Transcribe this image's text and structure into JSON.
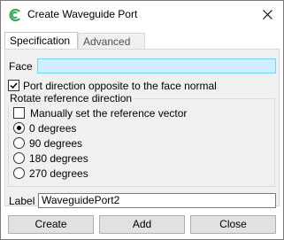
{
  "window": {
    "title": "Create Waveguide Port",
    "app_icon": "cst-logo-icon",
    "close_icon": "close-icon"
  },
  "tabs": [
    {
      "label": "Specification",
      "active": true
    },
    {
      "label": "Advanced",
      "active": false
    }
  ],
  "face": {
    "label": "Face",
    "value": ""
  },
  "opposite_direction": {
    "label": "Port direction opposite to the face normal",
    "checked": true
  },
  "reference_group": {
    "title": "Rotate reference direction",
    "manual_vector": {
      "label": "Manually set the reference vector",
      "checked": false
    },
    "options": [
      {
        "label": "0 degrees",
        "selected": true
      },
      {
        "label": "90 degrees",
        "selected": false
      },
      {
        "label": "180 degrees",
        "selected": false
      },
      {
        "label": "270 degrees",
        "selected": false
      }
    ]
  },
  "label_field": {
    "label": "Label",
    "value": "WaveguidePort2"
  },
  "buttons": {
    "create": "Create",
    "add": "Add",
    "close": "Close"
  },
  "colors": {
    "face_input_bg": "#cfefff",
    "icon_green": "#3aa85a"
  }
}
